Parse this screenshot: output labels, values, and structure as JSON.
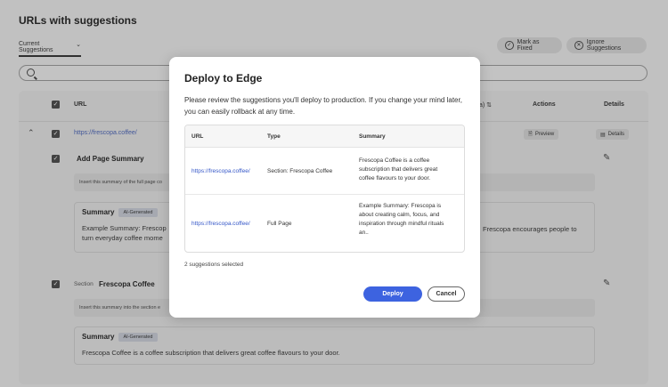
{
  "page": {
    "title": "URLs with suggestions",
    "view_picker": "Current Suggestions",
    "mark_fixed_label": "Mark as Fixed",
    "ignore_label": "Ignore Suggestions",
    "search_placeholder": ""
  },
  "table": {
    "headers": {
      "url": "URL",
      "partial": "a) ⇅",
      "actions": "Actions",
      "details": "Details"
    },
    "row": {
      "url": "https://frescopa.coffee/",
      "preview_label": "Preview",
      "details_label": "Details"
    },
    "section1": {
      "title": "Add Page Summary",
      "hint": "Insert this summary of the full page co",
      "summary_title": "Summary",
      "ai_tag": "AI-Generated",
      "summary_left": "Example Summary: Frescop",
      "summary_left_2": "turn everyday coffee mome",
      "summary_right": "Frescopa encourages people to"
    },
    "section2": {
      "label": "Section",
      "title": "Frescopa Coffee",
      "hint": "Insert this summary into the section e",
      "summary_title": "Summary",
      "ai_tag": "AI-Generated",
      "summary_text": "Frescopa Coffee is a coffee subscription that delivers great coffee flavours to your door."
    }
  },
  "modal": {
    "title": "Deploy to Edge",
    "description": "Please review the suggestions you'll deploy to production. If you change your mind later, you can easily rollback at any time.",
    "columns": {
      "url": "URL",
      "type": "Type",
      "summary": "Summary"
    },
    "rows": [
      {
        "url": "https://frescopa.coffee/",
        "type": "Section: Frescopa Coffee",
        "summary": "Frescopa Coffee is a coffee subscription that delivers great coffee flavours to your door."
      },
      {
        "url": "https://frescopa.coffee/",
        "type": "Full Page",
        "summary": "Example Summary: Frescopa is about creating calm, focus, and inspiration through mindful rituals an.."
      }
    ],
    "selected_count": "2 suggestions selected",
    "deploy_label": "Deploy",
    "cancel_label": "Cancel"
  },
  "colors": {
    "accent": "#3d63e0",
    "link": "#3557c8"
  }
}
